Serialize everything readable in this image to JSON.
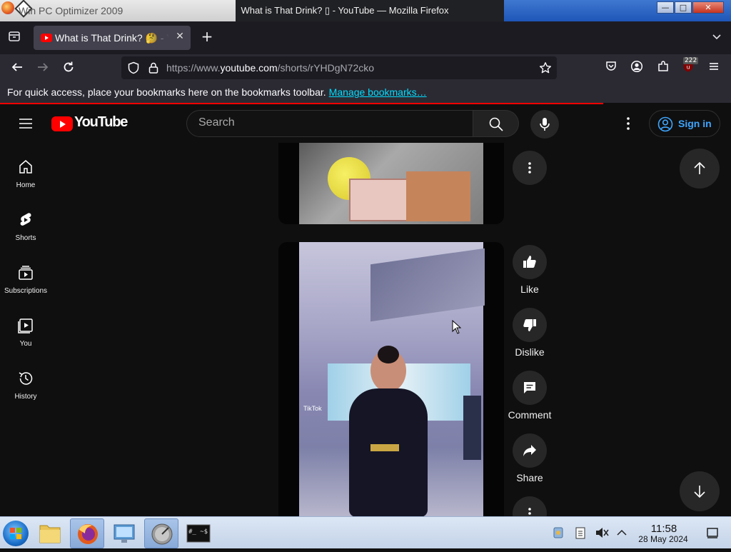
{
  "os_titlebar": {
    "background_window_title": "Win PC Optimizer 2009",
    "firefox_window_title": "What is That Drink? ▯ - YouTube — Mozilla Firefox",
    "buttons": [
      "minimize",
      "maximize",
      "close"
    ]
  },
  "browser": {
    "tab": {
      "label": "What is That Drink? 🤔 - YouTube",
      "close_label": "✕"
    },
    "new_tab_label": "+",
    "url": {
      "prefix": "https://www.",
      "domain": "youtube.com",
      "path": "/shorts/rYHDgN72cko"
    },
    "extension_badge": "222",
    "bookmarks_bar": {
      "message": "For quick access, place your bookmarks here on the bookmarks toolbar.",
      "link": "Manage bookmarks…"
    }
  },
  "youtube": {
    "logo_text": "YouTube",
    "search_placeholder": "Search",
    "sign_in_label": "Sign in",
    "sidebar": [
      {
        "label": "Home",
        "icon": "home-icon"
      },
      {
        "label": "Shorts",
        "icon": "shorts-icon"
      },
      {
        "label": "Subscriptions",
        "icon": "subscriptions-icon"
      },
      {
        "label": "You",
        "icon": "you-icon"
      },
      {
        "label": "History",
        "icon": "history-icon"
      }
    ],
    "actions": {
      "like": "Like",
      "dislike": "Dislike",
      "comment": "Comment",
      "share": "Share"
    },
    "video_watermark": "TikTok"
  },
  "taskbar": {
    "clock_time": "11:58",
    "clock_date": "28 May 2024",
    "terminal_label": "#_ ~$"
  },
  "colors": {
    "youtube_red": "#ff0000",
    "link_blue": "#3ea6ff",
    "bookmark_link": "#00ddff",
    "page_bg": "#0f0f0f"
  }
}
